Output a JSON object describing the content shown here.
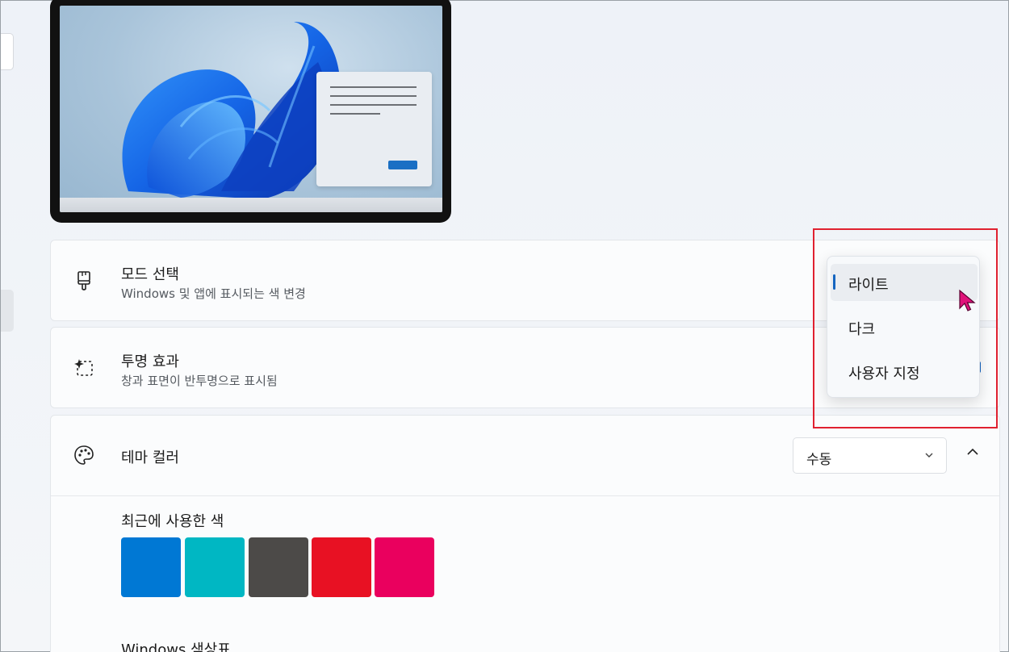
{
  "mode": {
    "title": "모드 선택",
    "subtitle": "Windows 및 앱에 표시되는 색 변경"
  },
  "transparency": {
    "title": "투명 효과",
    "subtitle": "창과 표면이 반투명으로 표시됨"
  },
  "theme_color": {
    "title": "테마 컬러",
    "dropdown_value": "수동",
    "recent_label": "최근에 사용한 색",
    "recent_colors": [
      "#0078d4",
      "#00b7c3",
      "#4c4a48",
      "#e81123",
      "#ea005e"
    ],
    "palette_label": "Windows 색상표"
  },
  "mode_menu": {
    "items": [
      {
        "label": "라이트",
        "selected": true
      },
      {
        "label": "다크",
        "selected": false
      },
      {
        "label": "사용자 지정",
        "selected": false
      }
    ]
  },
  "icons": {
    "mode": "paint-brush-icon",
    "transparency": "sparkle-dashed-square-icon",
    "theme_color": "palette-icon",
    "dropdown": "chevron-down-icon",
    "collapse": "chevron-up-icon",
    "cursor": "mouse-pointer-icon"
  },
  "colors": {
    "accent": "#1565c0",
    "highlight_box": "#e02130",
    "cursor": "#e0127a"
  }
}
